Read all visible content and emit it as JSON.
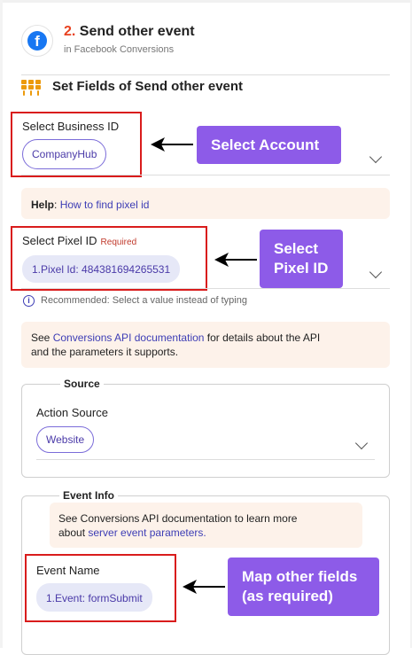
{
  "step": {
    "number": "2.",
    "title": "Send other event",
    "subtitle": "in Facebook Conversions",
    "icon": "facebook-icon"
  },
  "section": {
    "title": "Set Fields of Send other event",
    "icon": "fields-icon"
  },
  "business": {
    "label": "Select Business ID",
    "value": "CompanyHub"
  },
  "callout_account": "Select Account",
  "help": {
    "prefix": "Help",
    "sep": ": ",
    "link": "How to find pixel id"
  },
  "pixel": {
    "label": "Select Pixel ID",
    "required": "Required",
    "value": "1.Pixel Id: 484381694265531"
  },
  "callout_pixel": {
    "line1": "Select",
    "line2": "Pixel ID"
  },
  "recommend": "Recommended: Select a value instead of typing",
  "conversions_note": {
    "pre": "See ",
    "link": "Conversions API documentation",
    "post1": " for details about the API",
    "post2": "and the parameters it supports."
  },
  "source": {
    "legend": "Source",
    "label": "Action Source",
    "value": "Website"
  },
  "event_info": {
    "legend": "Event Info",
    "note_line1": "See Conversions API documentation to learn more",
    "note_line2_pre": "about ",
    "note_link": "server event parameters."
  },
  "event_name": {
    "label": "Event Name",
    "value": "1.Event: formSubmit"
  },
  "callout_map": {
    "line1": "Map other fields",
    "line2": "(as required)"
  },
  "colors": {
    "accent": "#8d5be8",
    "highlight": "#d91c1c",
    "facebook": "#1877f2",
    "step_number": "#e8411f"
  }
}
